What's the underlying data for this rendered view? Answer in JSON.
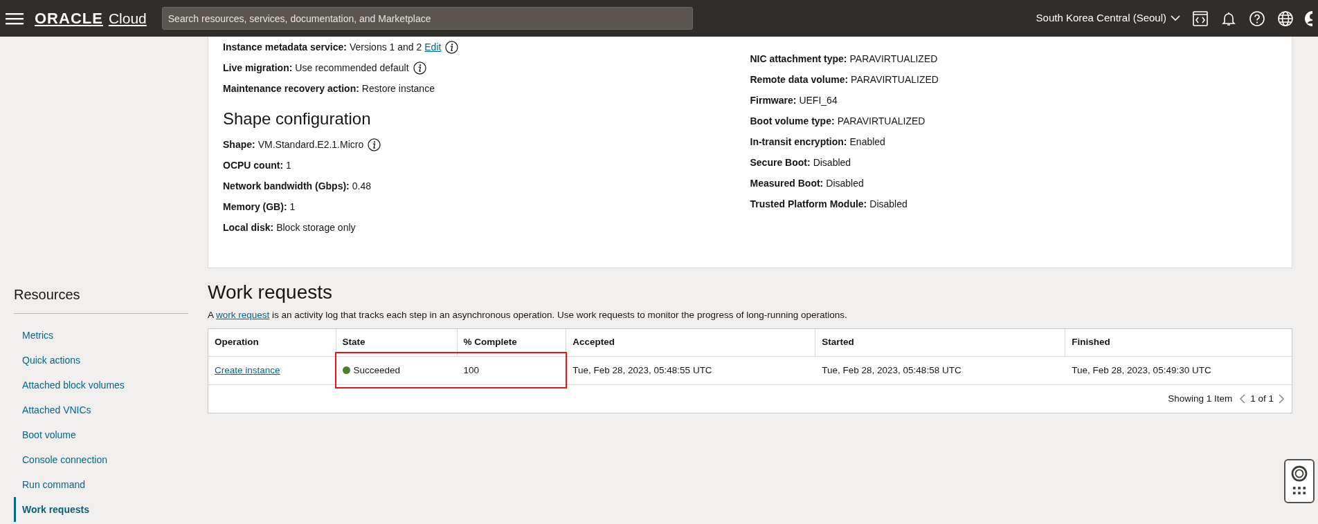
{
  "navbar": {
    "brand": {
      "name": "ORACLE",
      "product": "Cloud"
    },
    "search": {
      "placeholder": "Search resources, services, documentation, and Marketplace"
    },
    "region": "South Korea Central (Seoul)"
  },
  "details": {
    "left_fields": [
      {
        "label": "Instance metadata service:",
        "value": "Versions 1 and 2",
        "link": "Edit",
        "info": true
      },
      {
        "label": "Live migration:",
        "value": "Use recommended default",
        "info": true
      },
      {
        "label": "Maintenance recovery action:",
        "value": "Restore instance"
      }
    ],
    "shape_section": {
      "title": "Shape configuration",
      "fields": [
        {
          "label": "Shape:",
          "value": "VM.Standard.E2.1.Micro",
          "info": true
        },
        {
          "label": "OCPU count:",
          "value": "1"
        },
        {
          "label": "Network bandwidth (Gbps):",
          "value": "0.48"
        },
        {
          "label": "Memory (GB):",
          "value": "1"
        },
        {
          "label": "Local disk:",
          "value": "Block storage only"
        }
      ]
    },
    "right_fields": [
      {
        "label": "NIC attachment type:",
        "value": "PARAVIRTUALIZED"
      },
      {
        "label": "Remote data volume:",
        "value": "PARAVIRTUALIZED"
      },
      {
        "label": "Firmware:",
        "value": "UEFI_64"
      },
      {
        "label": "Boot volume type:",
        "value": "PARAVIRTUALIZED"
      },
      {
        "label": "In-transit encryption:",
        "value": "Enabled"
      },
      {
        "label": "Secure Boot:",
        "value": "Disabled"
      },
      {
        "label": "Measured Boot:",
        "value": "Disabled"
      },
      {
        "label": "Trusted Platform Module:",
        "value": "Disabled"
      }
    ]
  },
  "sidebar": {
    "title": "Resources",
    "items": [
      {
        "label": "Metrics",
        "selected": false
      },
      {
        "label": "Quick actions",
        "selected": false
      },
      {
        "label": "Attached block volumes",
        "selected": false
      },
      {
        "label": "Attached VNICs",
        "selected": false
      },
      {
        "label": "Boot volume",
        "selected": false
      },
      {
        "label": "Console connection",
        "selected": false
      },
      {
        "label": "Run command",
        "selected": false
      },
      {
        "label": "Work requests",
        "selected": true
      }
    ]
  },
  "work_requests": {
    "title": "Work requests",
    "description": {
      "before": "A ",
      "link": "work request",
      "after": " is an activity log that tracks each step in an asynchronous operation. Use work requests to monitor the progress of long-running operations."
    },
    "table": {
      "columns": [
        "Operation",
        "State",
        "% Complete",
        "Accepted",
        "Started",
        "Finished"
      ],
      "rows": [
        {
          "cells": [
            {
              "kind": "link",
              "text": "Create instance"
            },
            {
              "kind": "status",
              "text": "Succeeded",
              "color": "#4e7f2a",
              "highlighted": true
            },
            {
              "kind": "text",
              "text": "100",
              "highlighted": true
            },
            {
              "kind": "text",
              "text": "Tue, Feb 28, 2023, 05:48:55 UTC"
            },
            {
              "kind": "text",
              "text": "Tue, Feb 28, 2023, 05:48:58 UTC"
            },
            {
              "kind": "text",
              "text": "Tue, Feb 28, 2023, 05:49:30 UTC"
            }
          ]
        }
      ],
      "footer": {
        "count": "Showing 1 Item",
        "page": "1 of 1"
      }
    }
  }
}
